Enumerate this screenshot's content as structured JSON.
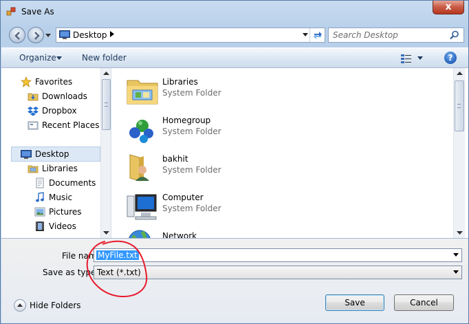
{
  "window": {
    "title": "Save As",
    "close_label": "x"
  },
  "navigation": {
    "address": "Desktop",
    "search_placeholder": "Search Desktop"
  },
  "toolbar": {
    "organize_label": "Organize",
    "new_folder_label": "New folder",
    "help_label": "?"
  },
  "nav_pane": {
    "items": [
      {
        "label": "Favorites",
        "icon": "star-icon"
      },
      {
        "label": "Downloads",
        "icon": "downloads-folder-icon"
      },
      {
        "label": "Dropbox",
        "icon": "dropbox-icon"
      },
      {
        "label": "Recent Places",
        "icon": "recent-places-icon"
      },
      {
        "label": "Desktop",
        "icon": "desktop-icon"
      },
      {
        "label": "Libraries",
        "icon": "libraries-icon"
      },
      {
        "label": "Documents",
        "icon": "documents-icon"
      },
      {
        "label": "Music",
        "icon": "music-icon"
      },
      {
        "label": "Pictures",
        "icon": "pictures-icon"
      },
      {
        "label": "Videos",
        "icon": "videos-icon"
      }
    ]
  },
  "content": {
    "items": [
      {
        "name": "Libraries",
        "type": "System Folder",
        "icon": "libraries-folder-icon"
      },
      {
        "name": "Homegroup",
        "type": "System Folder",
        "icon": "homegroup-icon"
      },
      {
        "name": "bakhit",
        "type": "System Folder",
        "icon": "user-folder-icon"
      },
      {
        "name": "Computer",
        "type": "System Folder",
        "icon": "computer-icon"
      },
      {
        "name": "Network",
        "type": "",
        "icon": "network-icon"
      }
    ]
  },
  "form": {
    "file_name_label": "File name:",
    "file_name_value": "MyFile.txt",
    "save_type_label": "Save as type:",
    "save_type_value": "Text (*.txt)",
    "hide_folders_label": "Hide Folders",
    "save_label": "Save",
    "cancel_label": "Cancel"
  },
  "colors": {
    "selection": "#3399ff",
    "annotation": "#e8192c",
    "frame": "#bcd3ec"
  }
}
